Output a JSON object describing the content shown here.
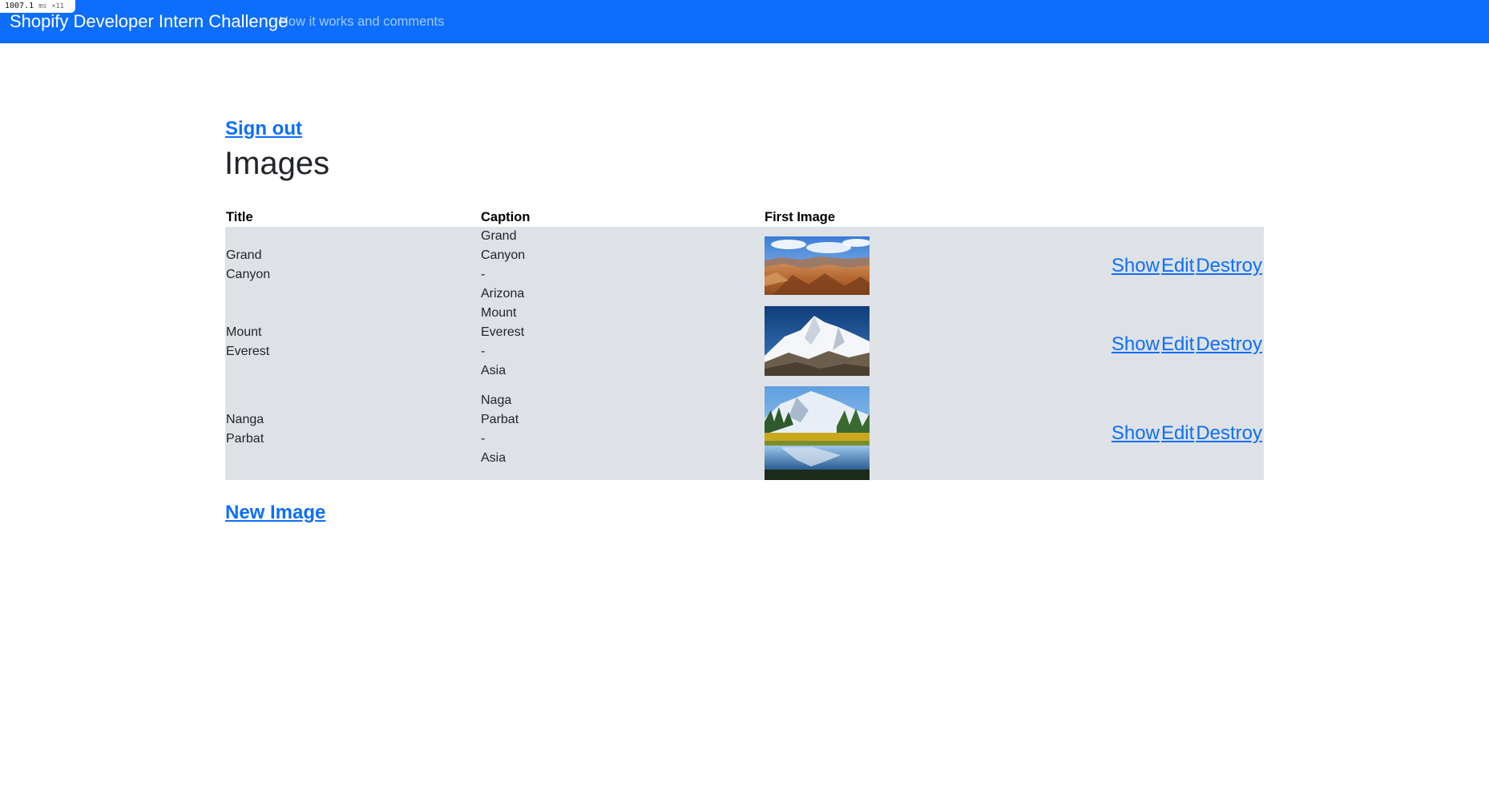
{
  "navbar": {
    "brand": "Shopify Developer Intern Challenge",
    "link": "How it works and comments",
    "perf_value": "1007.1",
    "perf_unit": "ms",
    "perf_count": "×11"
  },
  "page": {
    "sign_out": "Sign out",
    "title": "Images",
    "new_image": "New Image"
  },
  "table": {
    "headers": [
      "Title",
      "Caption",
      "First Image"
    ],
    "rows": [
      {
        "title_lines": [
          "Grand",
          "Canyon"
        ],
        "caption_lines": [
          "Grand",
          "Canyon",
          "-",
          "Arizona"
        ],
        "image": "grand-canyon-photo",
        "actions": [
          "Show",
          "Edit",
          "Destroy"
        ]
      },
      {
        "title_lines": [
          "Mount",
          "Everest"
        ],
        "caption_lines": [
          "Mount",
          "Everest",
          "-",
          "Asia"
        ],
        "image": "mount-everest-photo",
        "actions": [
          "Show",
          "Edit",
          "Destroy"
        ]
      },
      {
        "title_lines": [
          "Nanga",
          "Parbat"
        ],
        "caption_lines": [
          "Naga",
          "Parbat",
          "-",
          "Asia"
        ],
        "image": "nanga-parbat-photo",
        "actions": [
          "Show",
          "Edit",
          "Destroy"
        ]
      }
    ]
  }
}
